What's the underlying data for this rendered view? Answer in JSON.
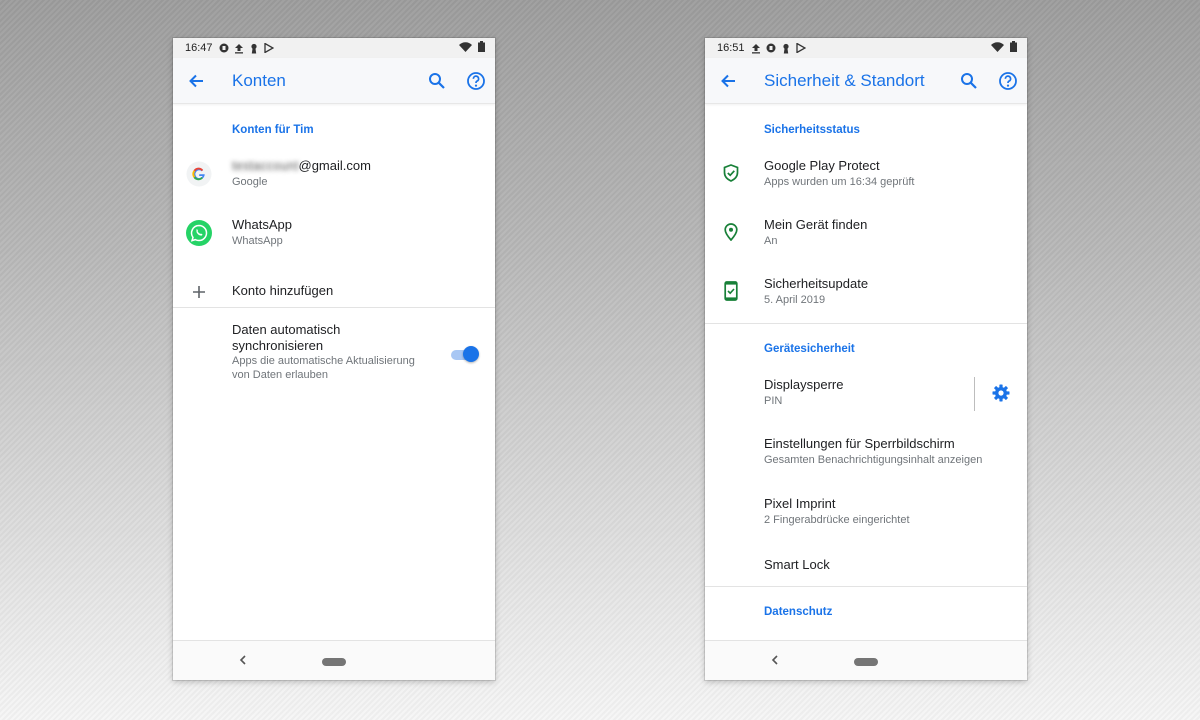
{
  "left_phone": {
    "status": {
      "time": "16:47"
    },
    "appbar": {
      "title": "Konten"
    },
    "section_header": "Konten für Tim",
    "accounts": [
      {
        "title_blurred": "testaccount",
        "title_suffix": "@gmail.com",
        "subtitle": "Google",
        "icon": "google-icon"
      },
      {
        "title": "WhatsApp",
        "subtitle": "WhatsApp",
        "icon": "whatsapp-icon"
      }
    ],
    "add_account": {
      "label": "Konto hinzufügen",
      "icon": "plus-icon"
    },
    "auto_sync": {
      "title_line1": "Daten automatisch",
      "title_line2": "synchronisieren",
      "desc_line1": "Apps die automatische Aktualisierung",
      "desc_line2": "von Daten erlauben",
      "enabled": true
    }
  },
  "right_phone": {
    "status": {
      "time": "16:51"
    },
    "appbar": {
      "title": "Sicherheit & Standort"
    },
    "section_security_status": "Sicherheitsstatus",
    "status_items": [
      {
        "title": "Google Play Protect",
        "subtitle": "Apps wurden um 16:34 geprüft",
        "icon": "shield-check-icon"
      },
      {
        "title": "Mein Gerät finden",
        "subtitle": "An",
        "icon": "location-pin-icon"
      },
      {
        "title": "Sicherheitsupdate",
        "subtitle": "5. April 2019",
        "icon": "phone-check-icon"
      }
    ],
    "section_device_security": "Gerätesicherheit",
    "device_items": [
      {
        "title": "Displaysperre",
        "subtitle": "PIN"
      },
      {
        "title": "Einstellungen für Sperrbildschirm",
        "subtitle": "Gesamten Benachrichtigungsinhalt anzeigen"
      },
      {
        "title": "Pixel Imprint",
        "subtitle": "2 Fingerabdrücke eingerichtet"
      },
      {
        "title": "Smart Lock",
        "subtitle": ""
      }
    ],
    "section_privacy": "Datenschutz"
  },
  "colors": {
    "accent": "#1a73e8",
    "secure_green": "#188038",
    "whatsapp_green": "#25d366"
  }
}
